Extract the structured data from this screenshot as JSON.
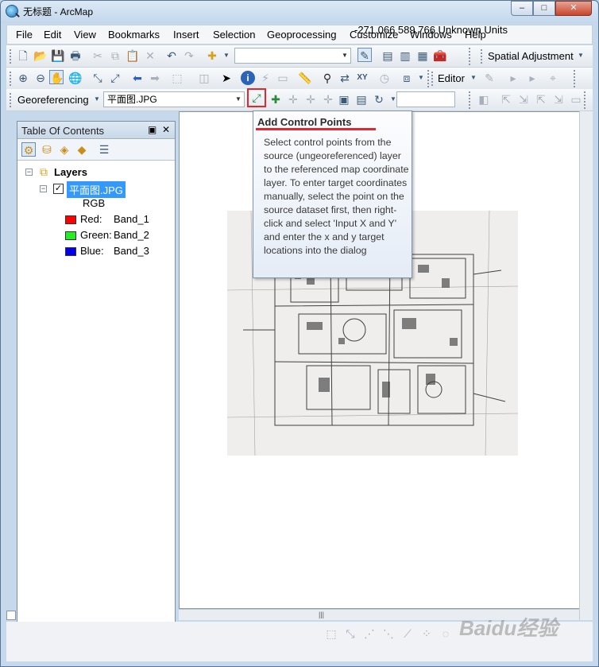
{
  "window": {
    "title": "无标题 - ArcMap",
    "controls": {
      "minimize": "–",
      "maximize": "□",
      "close": "✕"
    }
  },
  "menu": [
    "File",
    "Edit",
    "View",
    "Bookmarks",
    "Insert",
    "Selection",
    "Geoprocessing",
    "Customize",
    "Windows",
    "Help"
  ],
  "toolbar_standard": {
    "spatial_adjustment_label": "Spatial Adjustment",
    "scale_value": ""
  },
  "toolbar_tools": {
    "editor_label": "Editor"
  },
  "georef_toolbar": {
    "label": "Georeferencing",
    "layer_select": "平面图.JPG",
    "coord_value": ""
  },
  "toc": {
    "title": "Table Of Contents",
    "layers_label": "Layers",
    "layer_name": "平面图.JPG",
    "rgb_label": "RGB",
    "bands": [
      {
        "channel": "Red:",
        "band": "Band_1",
        "color": "#ff0000"
      },
      {
        "channel": "Green:",
        "band": "Band_2",
        "color": "#22ee22"
      },
      {
        "channel": "Blue:",
        "band": "Band_3",
        "color": "#0000ee"
      }
    ],
    "pin": "▣",
    "close": "✕"
  },
  "tooltip": {
    "title": "Add Control Points",
    "body": "Select control points from the source (ungeoreferenced) layer to the referenced map coordinate layer. To enter target coordinates manually, select the point on the source dataset first, then right-click and select 'Input X and Y' and enter the x and y target locations into the dialog"
  },
  "status": {
    "coordinates": "-271.066  589.766 Unknown Units"
  },
  "watermark": "Baidu经验"
}
